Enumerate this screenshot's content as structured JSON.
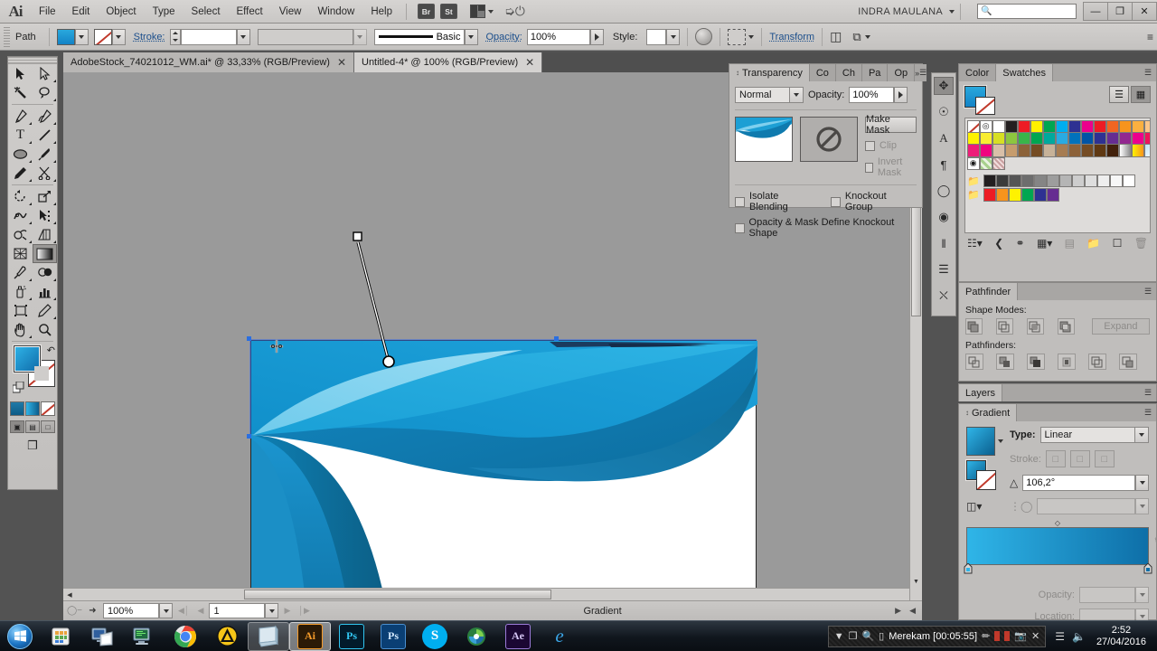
{
  "app": {
    "name": "Adobe Illustrator",
    "logo": "Ai",
    "user": "INDRA MAULANA"
  },
  "menubar": {
    "items": [
      "File",
      "Edit",
      "Object",
      "Type",
      "Select",
      "Effect",
      "View",
      "Window",
      "Help"
    ],
    "bridge_label": "Br",
    "stock_label": "St",
    "search_placeholder": "",
    "minimize": "—",
    "restore": "❐",
    "close": "✕"
  },
  "controlbar": {
    "selection_label": "Path",
    "stroke_label": "Stroke:",
    "stroke_weight": "",
    "stroke_profile": "",
    "brush_label": "Basic",
    "opacity_label": "Opacity:",
    "opacity_value": "100%",
    "style_label": "Style:",
    "transform_label": "Transform"
  },
  "tabs": [
    {
      "title": "AdobeStock_74021012_WM.ai* @ 33,33% (RGB/Preview)",
      "active": false,
      "close": "✕"
    },
    {
      "title": "Untitled-4* @ 100% (RGB/Preview)",
      "active": true,
      "close": "✕"
    }
  ],
  "toolbox": {
    "tools": [
      {
        "name": "selection-tool",
        "glyph": "➤"
      },
      {
        "name": "direct-selection-tool",
        "glyph": "➣"
      },
      {
        "name": "magic-wand-tool",
        "glyph": "✳"
      },
      {
        "name": "lasso-tool",
        "glyph": "ᗢ"
      },
      {
        "name": "pen-tool",
        "glyph": "✒"
      },
      {
        "name": "curvature-tool",
        "glyph": "✑"
      },
      {
        "name": "type-tool",
        "glyph": "T"
      },
      {
        "name": "line-segment-tool",
        "glyph": "╱"
      },
      {
        "name": "ellipse-tool",
        "glyph": "⬭"
      },
      {
        "name": "paintbrush-tool",
        "glyph": "🖌"
      },
      {
        "name": "pencil-tool",
        "glyph": "✏"
      },
      {
        "name": "scissors-tool",
        "glyph": "✂"
      },
      {
        "name": "rotate-tool",
        "glyph": "↻"
      },
      {
        "name": "scale-tool",
        "glyph": "⬈"
      },
      {
        "name": "width-tool",
        "glyph": "൭"
      },
      {
        "name": "free-transform-tool",
        "glyph": "⬚"
      },
      {
        "name": "shape-builder-tool",
        "glyph": "⌾"
      },
      {
        "name": "perspective-grid-tool",
        "glyph": "▥"
      },
      {
        "name": "mesh-tool",
        "glyph": "▩"
      },
      {
        "name": "gradient-tool",
        "glyph": "▤"
      },
      {
        "name": "eyedropper-tool",
        "glyph": "⌇"
      },
      {
        "name": "blend-tool",
        "glyph": "◕"
      },
      {
        "name": "symbol-sprayer-tool",
        "glyph": "⛾"
      },
      {
        "name": "column-graph-tool",
        "glyph": "▦"
      },
      {
        "name": "artboard-tool",
        "glyph": "⬓"
      },
      {
        "name": "slice-tool",
        "glyph": "✎"
      },
      {
        "name": "hand-tool",
        "glyph": "✋"
      },
      {
        "name": "zoom-tool",
        "glyph": "🔍"
      }
    ],
    "active_tool": "gradient-tool",
    "fill_color": "#1383c6",
    "stroke_color": "#ffffff",
    "draw_modes": [
      "draw-normal",
      "draw-behind",
      "draw-inside"
    ],
    "screen_mode": "change-screen-mode"
  },
  "transparency_panel": {
    "tabs": [
      "Transparency",
      "Co",
      "Ch",
      "Pa",
      "Op"
    ],
    "active_tab": "Transparency",
    "blend_mode": "Normal",
    "opacity_label": "Opacity:",
    "opacity_value": "100%",
    "make_mask_label": "Make Mask",
    "clip_label": "Clip",
    "invert_mask_label": "Invert Mask",
    "isolate_blending_label": "Isolate Blending",
    "knockout_group_label": "Knockout Group",
    "knockout_shape_label": "Opacity & Mask Define Knockout Shape"
  },
  "swatches_panel": {
    "tabs": [
      "Color",
      "Swatches"
    ],
    "active_tab": "Swatches",
    "fill_color": "#1383c6",
    "row1": [
      "none",
      "registration",
      "#ffffff",
      "#231f20",
      "#ed1c24",
      "#fff200",
      "#00a651",
      "#00aeef",
      "#2e3192",
      "#ec008c",
      "#ed1c24",
      "#f26522",
      "#f7941d",
      "#fbb040",
      "#fdc689"
    ],
    "row2": [
      "#fff200",
      "#f9ed32",
      "#d7df23",
      "#8dc63f",
      "#39b54a",
      "#00a651",
      "#00a99d",
      "#29abe2",
      "#0072bc",
      "#0054a6",
      "#2e3192",
      "#662d91",
      "#92278f",
      "#ec008c",
      "#ed145b"
    ],
    "row3": [
      "#ed1e79",
      "#f0047f",
      "#d9bfa8",
      "#c69c6d",
      "#8c6239",
      "#754c24",
      "#c7b299",
      "#a67c52",
      "#8c6239",
      "#754c24",
      "#603913",
      "#42210b",
      "#e0e0e0",
      "#f5c242",
      "#bfe3f5"
    ],
    "row4": [
      "#ffffff",
      "#a8d18d",
      "#c9a0a0"
    ],
    "gray_row": [
      "#231f20",
      "#3b3b3b",
      "#555555",
      "#6d6d6d",
      "#858585",
      "#9d9d9d",
      "#b5b5b5",
      "#cdcdcd",
      "#dedede",
      "#eeeeee",
      "#f7f7f7",
      "#ffffff"
    ],
    "bright_row": [
      "#ed1c24",
      "#f7941d",
      "#fff200",
      "#00a651",
      "#2e3192",
      "#662d91"
    ],
    "footer_icons": [
      "swatch-libraries-icon",
      "swatch-links-icon",
      "show-swatch-kinds-icon",
      "swatch-options-icon",
      "new-color-group-icon",
      "new-swatch-icon",
      "delete-swatch-icon"
    ]
  },
  "pathfinder_panel": {
    "tab": "Pathfinder",
    "shape_modes_label": "Shape Modes:",
    "pathfinders_label": "Pathfinders:",
    "expand_label": "Expand",
    "shape_mode_buttons": [
      "unite",
      "minus-front",
      "intersect",
      "exclude"
    ],
    "pathfinder_buttons": [
      "divide",
      "trim",
      "merge",
      "crop",
      "outline",
      "minus-back"
    ]
  },
  "layers_panel": {
    "tab": "Layers"
  },
  "gradient_panel": {
    "tab": "Gradient",
    "type_label": "Type:",
    "type_value": "Linear",
    "stroke_label": "Stroke:",
    "angle_label": "angle",
    "angle_value": "106,2°",
    "aspect_label": "aspect-ratio",
    "opacity_label": "Opacity:",
    "location_label": "Location:",
    "gradient_start": "#2fb5e8",
    "gradient_end": "#0e6fa8",
    "reverse_label": "reverse-gradient"
  },
  "dock_icons": [
    "brushes-icon",
    "symbols-icon",
    "character-icon",
    "paragraph-icon",
    "appearance-icon",
    "graphic-styles-icon",
    "align-icon",
    "transform-icon",
    "artboards-icon",
    "links-icon"
  ],
  "statusbar": {
    "zoom_value": "100%",
    "artboard_number": "1",
    "status_text": "Gradient",
    "first_label": "first-artboard",
    "prev_label": "previous-artboard",
    "next_label": "next-artboard",
    "last_label": "last-artboard"
  },
  "artwork": {
    "gradient_handle_start": "square-handle",
    "gradient_handle_end": "round-handle",
    "colors": {
      "dark_blue": "#0f7bb0",
      "mid_blue": "#1b94cc",
      "light_blue": "#5ec4e8",
      "pale_blue": "#8ad6f0",
      "deep_blue": "#0c5f8a",
      "navy": "#1b3a5c"
    }
  },
  "taskbar": {
    "items": [
      {
        "name": "start-button",
        "label": ""
      },
      {
        "name": "taskbar-show-desktop",
        "label": ""
      },
      {
        "name": "taskbar-item-explorer",
        "label": ""
      },
      {
        "name": "taskbar-item-computer",
        "label": ""
      },
      {
        "name": "taskbar-item-chrome",
        "label": ""
      },
      {
        "name": "taskbar-item-utorrent",
        "label": ""
      },
      {
        "name": "taskbar-item-window",
        "label": ""
      },
      {
        "name": "taskbar-item-illustrator",
        "label": "Ai"
      },
      {
        "name": "taskbar-item-photoshop",
        "label": "Ps"
      },
      {
        "name": "taskbar-item-photoshop-2",
        "label": "Ps"
      },
      {
        "name": "taskbar-item-skype",
        "label": "S"
      },
      {
        "name": "taskbar-item-idm",
        "label": ""
      },
      {
        "name": "taskbar-item-aftereffects",
        "label": "Ae"
      },
      {
        "name": "taskbar-item-internet-explorer",
        "label": "e"
      }
    ],
    "recorder": {
      "status_text": "Merekam [00:05:55]",
      "pen_icon": "pen-icon",
      "pause_icon": "pause-icon",
      "stop_icon": "stop-icon",
      "camera_icon": "camera-icon",
      "close_icon": "✕",
      "dropdown_icon": "▼",
      "window_icon": "window-icon",
      "zoom_icon": "zoom-icon",
      "region_icon": "region-icon"
    },
    "clock": {
      "time": "2:52",
      "date": "27/04/2016"
    }
  }
}
